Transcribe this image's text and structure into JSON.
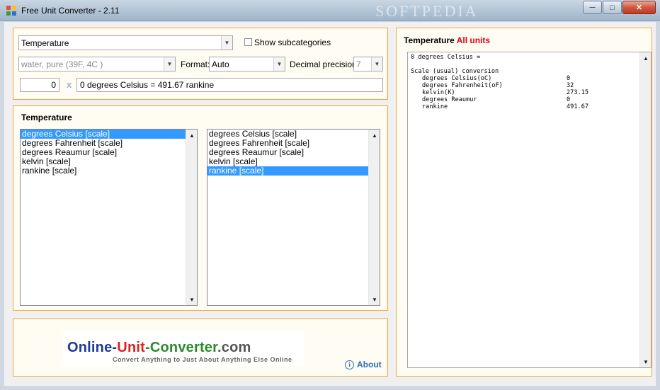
{
  "window": {
    "title": "Free Unit Converter - 2.11",
    "watermark": "SOFTPEDIA",
    "icons": {
      "app": "app-converter-icon",
      "minimize": "minimize-icon",
      "maximize": "maximize-icon",
      "close": "close-icon"
    }
  },
  "top": {
    "category": "Temperature",
    "show_subcategories_label": "Show subcategories",
    "show_subcategories_checked": false,
    "substance": "water, pure (39F, 4C )",
    "format_label": "Format:",
    "format_value": "Auto",
    "precision_label": "Decimal precision:",
    "precision_value": "7",
    "input_value": "0",
    "multiply_sign": "x",
    "conversion_result": "0 degrees Celsius = 491.67 rankine"
  },
  "lists": {
    "title": "Temperature",
    "from_units": [
      {
        "label": "degrees Celsius [scale]",
        "selected": true
      },
      {
        "label": "degrees Fahrenheit [scale]",
        "selected": false
      },
      {
        "label": "degrees Reaumur [scale]",
        "selected": false
      },
      {
        "label": "kelvin [scale]",
        "selected": false
      },
      {
        "label": "rankine [scale]",
        "selected": false
      }
    ],
    "to_units": [
      {
        "label": "degrees Celsius [scale]",
        "selected": false
      },
      {
        "label": "degrees Fahrenheit [scale]",
        "selected": false
      },
      {
        "label": "degrees Reaumur [scale]",
        "selected": false
      },
      {
        "label": "kelvin [scale]",
        "selected": false
      },
      {
        "label": "rankine [scale]",
        "selected": true
      }
    ]
  },
  "ad": {
    "logo_part1": "Online-",
    "logo_part2": "Unit",
    "logo_part3": "-Converter",
    "logo_part4": ".com",
    "tagline": "Convert Anything to Just About Anything Else Online",
    "about_label": "About"
  },
  "all_units": {
    "title": "Temperature",
    "title_accent": "All units",
    "header_line": "0 degrees Celsius =",
    "section_label": "Scale (usual) conversion",
    "rows": [
      {
        "unit": "degrees Celsius(oC)",
        "value": "0"
      },
      {
        "unit": "degrees Fahrenheit(oF)",
        "value": "32"
      },
      {
        "unit": "kelvin(K)",
        "value": "273.15"
      },
      {
        "unit": "degrees Reaumur",
        "value": "0"
      },
      {
        "unit": "rankine",
        "value": "491.67"
      }
    ]
  },
  "colors": {
    "panel_border": "#f0a53a",
    "selection": "#3399ff",
    "accent_red": "#e0000f",
    "link_blue": "#2a6fb8"
  }
}
